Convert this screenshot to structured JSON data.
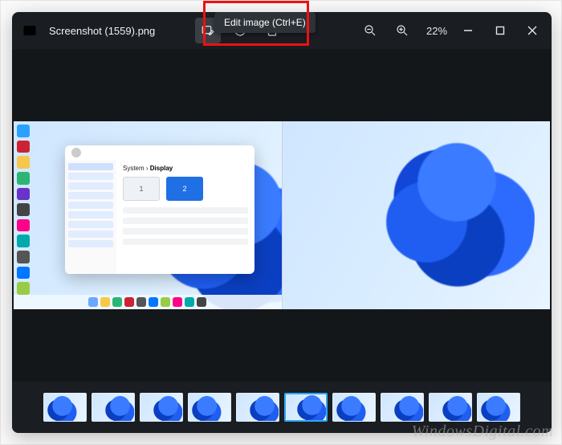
{
  "titlebar": {
    "filename": "Screenshot (1559).png",
    "zoom_label": "22%"
  },
  "tooltip": {
    "edit_image": "Edit image (Ctrl+E)"
  },
  "settings_window": {
    "breadcrumb_root": "System",
    "breadcrumb_sep": " › ",
    "breadcrumb_leaf": "Display",
    "monitor1": "1",
    "monitor2": "2"
  },
  "filmstrip": {
    "count": 10,
    "selected_index": 5
  },
  "watermark": "WindowsDigital.com"
}
